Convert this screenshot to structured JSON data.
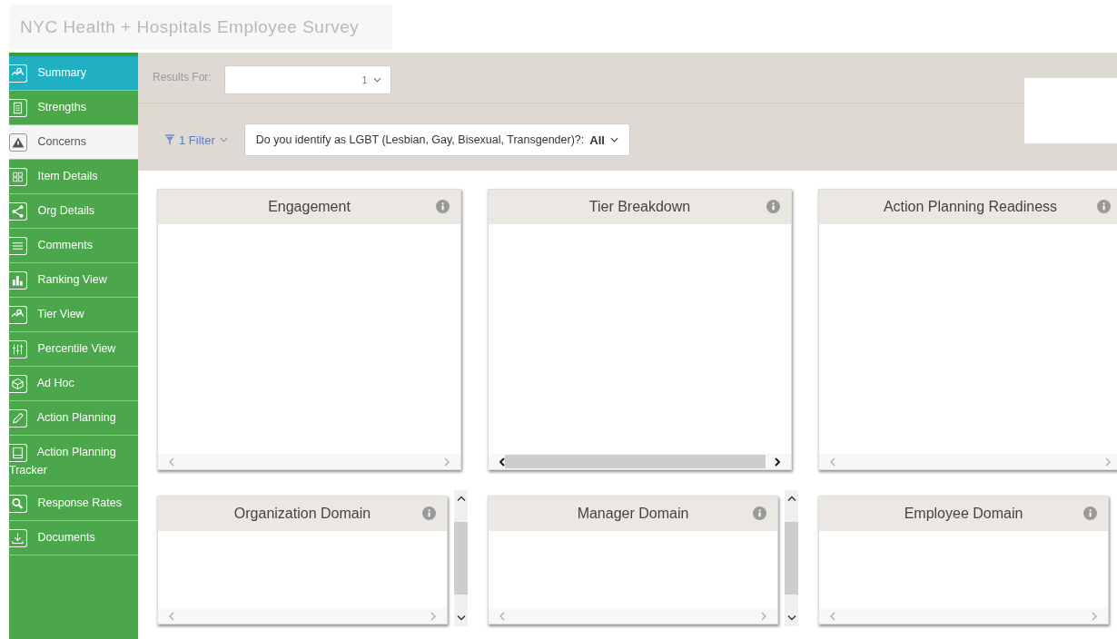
{
  "header": {
    "title": "NYC Health + Hospitals Employee Survey"
  },
  "sidebar": {
    "items": [
      {
        "label": "Summary",
        "selected": true,
        "disabled": false
      },
      {
        "label": "Strengths",
        "selected": false,
        "disabled": false
      },
      {
        "label": "Concerns",
        "selected": false,
        "disabled": true
      },
      {
        "label": "Item Details",
        "selected": false,
        "disabled": false
      },
      {
        "label": "Org Details",
        "selected": false,
        "disabled": false
      },
      {
        "label": "Comments",
        "selected": false,
        "disabled": false
      },
      {
        "label": "Ranking View",
        "selected": false,
        "disabled": false
      },
      {
        "label": "Tier View",
        "selected": false,
        "disabled": false
      },
      {
        "label": "Percentile View",
        "selected": false,
        "disabled": false
      },
      {
        "label": "Ad Hoc",
        "selected": false,
        "disabled": false
      },
      {
        "label": "Action Planning",
        "selected": false,
        "disabled": false
      },
      {
        "label": "Action Planning Tracker",
        "selected": false,
        "disabled": false
      },
      {
        "label": "Response Rates",
        "selected": false,
        "disabled": false
      },
      {
        "label": "Documents",
        "selected": false,
        "disabled": false
      }
    ]
  },
  "results_for": {
    "label": "Results For:",
    "value": "1"
  },
  "filter": {
    "label": "1 Filter",
    "question": "Do you identify as LGBT (Lesbian, Gay, Bisexual, Transgender)?:",
    "answer": "All"
  },
  "cards": [
    {
      "title": "Engagement",
      "kind": "plain",
      "scroll_thumb": false
    },
    {
      "title": "Tier Breakdown",
      "kind": "plain",
      "scroll_thumb": true
    },
    {
      "title": "Action Planning Readiness",
      "kind": "plain",
      "scroll_thumb": false
    },
    {
      "title": "Organization Domain",
      "kind": "side-scroll",
      "scroll_thumb": false
    },
    {
      "title": "Manager Domain",
      "kind": "side-scroll",
      "scroll_thumb": false
    },
    {
      "title": "Employee Domain",
      "kind": "plain",
      "scroll_thumb": false
    }
  ]
}
